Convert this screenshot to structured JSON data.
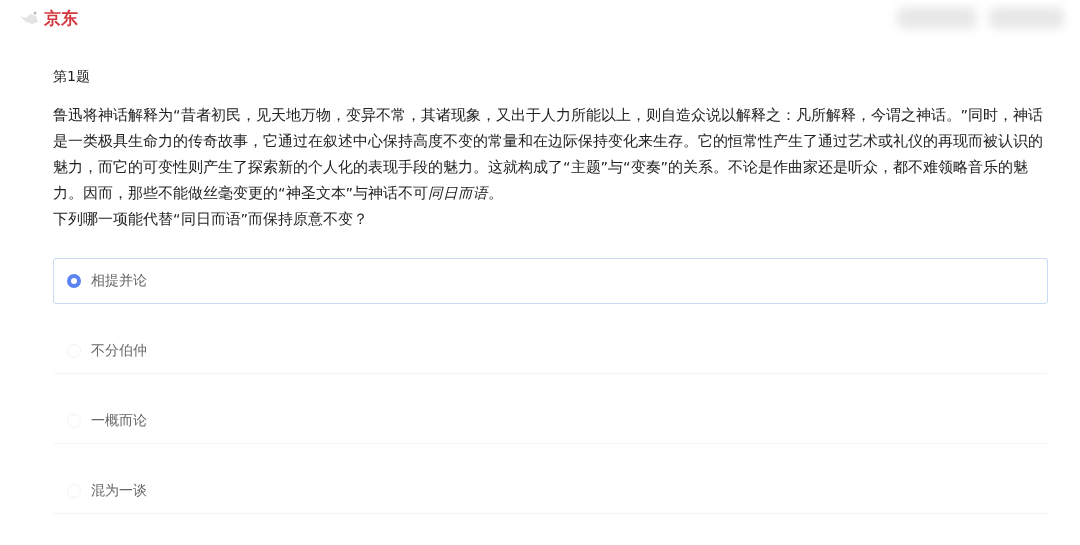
{
  "header": {
    "logo_text": "京东"
  },
  "question": {
    "number": "第1题",
    "passage": "鲁迅将神话解释为“昔者初民，见天地万物，变异不常，其诸现象，又出于人力所能以上，则自造众说以解释之：凡所解释，今谓之神话。”同时，神话是一类极具生命力的传奇故事，它通过在叙述中心保持高度不变的常量和在边际保持变化来生存。它的恒常性产生了通过艺术或礼仪的再现而被认识的魅力，而它的可变性则产生了探索新的个人化的表现手段的魅力。这就构成了“主题”与“变奏”的关系。不论是作曲家还是听众，都不难领略音乐的魅力。因而，那些不能做丝毫变更的“神圣文本”与神话不可",
    "passage_emphasis": "同日而语",
    "passage_end": "。",
    "prompt": "下列哪一项能代替“同日而语”而保持原意不变？"
  },
  "options": [
    {
      "label": "相提并论",
      "selected": true
    },
    {
      "label": "不分伯仲",
      "selected": false
    },
    {
      "label": "一概而论",
      "selected": false
    },
    {
      "label": "混为一谈",
      "selected": false
    }
  ]
}
